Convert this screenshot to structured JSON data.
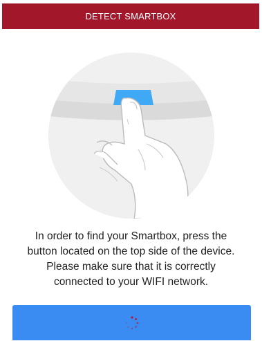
{
  "header": {
    "title": "DETECT SMARTBOX",
    "background_color": "#a3172b"
  },
  "illustration": {
    "icon": "finger-pressing-device-button-icon",
    "button_color": "#3fa9f5"
  },
  "instructions": {
    "line1": "In order to find your Smartbox, press the",
    "line2": "button located on the top side of the device.",
    "line3": "Please make sure that it is correctly",
    "line4": "connected to your WIFI network."
  },
  "action_button": {
    "state": "loading",
    "icon": "loading-spinner-icon",
    "background_color": "#3b8cf2",
    "spinner_color": "#b0183a"
  }
}
